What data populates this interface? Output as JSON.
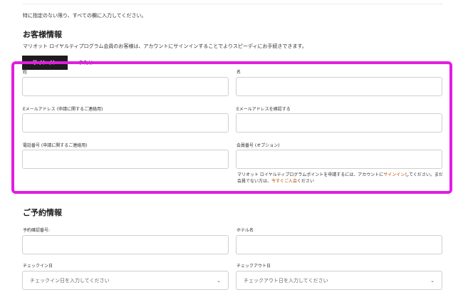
{
  "form": {
    "required_note": "特に指定のない限り、すべての欄に入力してください。",
    "customer_section": {
      "title": "お客様情報",
      "description": "マリオット ロイヤルティプログラム会員のお客様は、アカウントにサインインすることでよりスピーディにお手続きできます。",
      "signin_button": "サインイン",
      "or_text": "または",
      "last_name_label": "姓",
      "last_name_value": "",
      "first_name_label": "名",
      "first_name_value": "",
      "email_label": "Eメールアドレス (申請に関するご連絡用)",
      "email_value": "",
      "email_confirm_label": "Eメールアドレスを確認する",
      "email_confirm_value": "",
      "phone_label": "電話番号 (申請に関するご連絡用)",
      "phone_value": "",
      "member_label": "会員番号 (オプション)",
      "member_value": "",
      "member_help_1": "マリオット ロイヤルティプログラムポイントを申請するには、アカウントに",
      "member_help_signin": "サインイン",
      "member_help_2": "してください。まだ会員でない方は、",
      "member_help_join": "今すぐご入会",
      "member_help_3": "ください"
    },
    "reservation_section": {
      "title": "ご予約情報",
      "confirmation_label": "予約確認番号:",
      "confirmation_value": "",
      "hotel_label": "ホテル名",
      "hotel_value": "",
      "checkin_label": "チェックイン日",
      "checkin_placeholder": "チェックイン日を入力してください",
      "checkout_label": "チェックアウト日",
      "checkout_placeholder": "チェックアウト日を入力してください"
    }
  },
  "colors": {
    "highlight": "#e21ce3",
    "button_bg": "#1c1c1c",
    "link": "#b84a00"
  },
  "icons": {
    "select_chevron": "chevron-down-icon"
  }
}
